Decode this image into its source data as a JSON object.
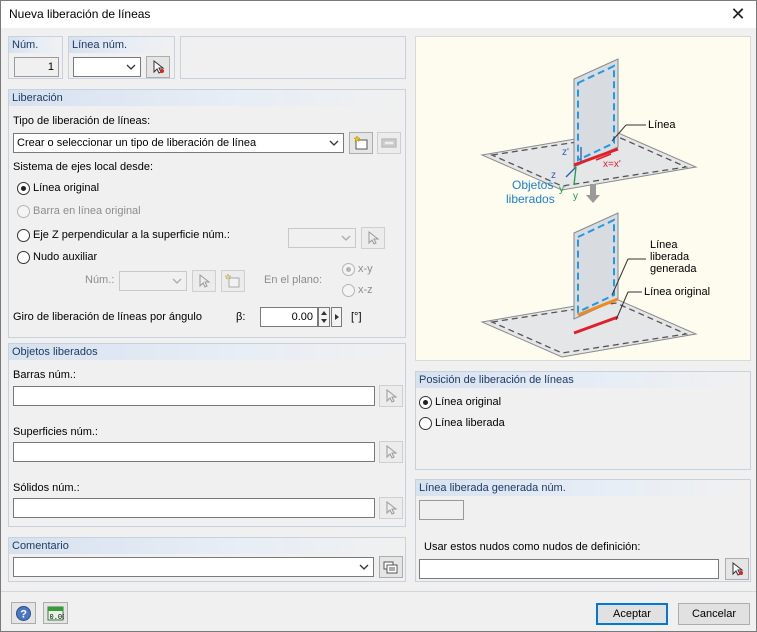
{
  "window": {
    "title": "Nueva liberación de líneas"
  },
  "num": {
    "header": "Núm.",
    "value": "1"
  },
  "linea_num": {
    "header": "Línea núm.",
    "value": ""
  },
  "liberacion": {
    "header": "Liberación",
    "tipo_label": "Tipo de liberación de líneas:",
    "tipo_value": "Crear o seleccionar un tipo de liberación de línea",
    "sistema_label": "Sistema de ejes local desde:",
    "opt_linea_original": "Línea original",
    "opt_barra": "Barra en línea original",
    "opt_eje_z": "Eje Z perpendicular a la superficie núm.:",
    "opt_nudo": "Nudo auxiliar",
    "num_label": "Núm.:",
    "en_plano_label": "En el plano:",
    "opt_xy": "x-y",
    "opt_xz": "x-z",
    "giro_label": "Giro de liberación de líneas por ángulo",
    "beta_label": "β:",
    "beta_value": "0.00",
    "beta_unit": "[°]"
  },
  "objetos": {
    "header": "Objetos liberados",
    "barras_label": "Barras núm.:",
    "superficies_label": "Superficies núm.:",
    "solidos_label": "Sólidos núm.:"
  },
  "comentario": {
    "header": "Comentario",
    "value": ""
  },
  "posicion": {
    "header": "Posición de liberación de líneas",
    "opt_original": "Línea original",
    "opt_liberada": "Línea liberada"
  },
  "generada": {
    "header": "Línea liberada generada núm.",
    "value": "",
    "nudos_label": "Usar estos nudos como nudos de definición:",
    "nudos_value": ""
  },
  "diagram": {
    "label_linea": "Línea",
    "label_objetos_1": "Objetos",
    "label_objetos_2": "liberados",
    "label_generada_1": "Línea",
    "label_generada_2": "liberada",
    "label_generada_3": "generada",
    "label_original": "Línea original",
    "axis_zp": "z'",
    "axis_z": "z",
    "axis_yp": "y'",
    "axis_y": "y",
    "axis_xx": "x=x'"
  },
  "footer": {
    "ok": "Aceptar",
    "cancel": "Cancelar"
  },
  "colors": {
    "accent_blue": "#0078d7",
    "release_red": "#e0202a",
    "release_orange": "#f08a1c",
    "dash_blue": "#1e9be6"
  }
}
